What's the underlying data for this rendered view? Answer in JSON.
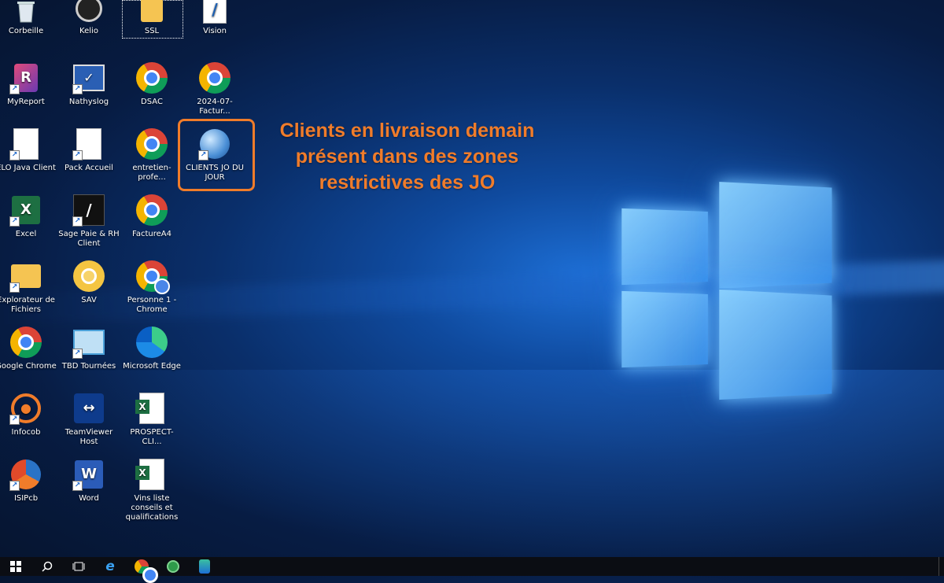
{
  "desktop": {
    "icons": [
      {
        "label": "Corbeille",
        "icon": "recycle-bin-icon"
      },
      {
        "label": "Kelio",
        "icon": "clock-icon"
      },
      {
        "label": "SSL",
        "icon": "folder-icon"
      },
      {
        "label": "Vision",
        "icon": "vision-app-icon"
      },
      {
        "label": "MyReport",
        "icon": "myreport-icon"
      },
      {
        "label": "Nathyslog",
        "icon": "nathyslog-icon"
      },
      {
        "label": "DSAC",
        "icon": "chrome-icon"
      },
      {
        "label": "2024-07-Factur...",
        "icon": "chrome-icon"
      },
      {
        "label": "ELO Java Client",
        "icon": "document-icon"
      },
      {
        "label": "Pack Accueil",
        "icon": "document-icon"
      },
      {
        "label": "entretien-profe...",
        "icon": "chrome-icon"
      },
      {
        "label": "CLIENTS JO DU JOUR",
        "icon": "globe-clock-icon"
      },
      {
        "label": "Excel",
        "icon": "excel-icon"
      },
      {
        "label": "Sage Paie & RH Client",
        "icon": "sage-icon"
      },
      {
        "label": "FactureA4",
        "icon": "chrome-icon"
      },
      {
        "label": "Explorateur de Fichiers",
        "icon": "file-explorer-icon"
      },
      {
        "label": "SAV",
        "icon": "chrome-yellow-icon"
      },
      {
        "label": "Personne 1 - Chrome",
        "icon": "chrome-profile-icon"
      },
      {
        "label": "Google Chrome",
        "icon": "chrome-icon"
      },
      {
        "label": "TBD Tournées",
        "icon": "tbd-icon"
      },
      {
        "label": "Microsoft Edge",
        "icon": "edge-icon"
      },
      {
        "label": "Infocob",
        "icon": "infocob-icon"
      },
      {
        "label": "TeamViewer Host",
        "icon": "teamviewer-icon"
      },
      {
        "label": "PROSPECT-CLI...",
        "icon": "excel-file-icon"
      },
      {
        "label": "ISIPcb",
        "icon": "isipcb-icon"
      },
      {
        "label": "Word",
        "icon": "word-icon"
      },
      {
        "label": "Vins liste conseils et qualifications",
        "icon": "excel-file-icon"
      }
    ]
  },
  "annotation": {
    "lines": [
      "Clients en livraison demain",
      "présent dans des zones",
      "restrictives des JO"
    ],
    "color": "#f07c2a"
  },
  "taskbar": {
    "items": [
      "start-icon",
      "search-icon",
      "task-view-icon",
      "internet-explorer-icon",
      "chrome-icon",
      "network-app-icon",
      "app-icon"
    ]
  }
}
